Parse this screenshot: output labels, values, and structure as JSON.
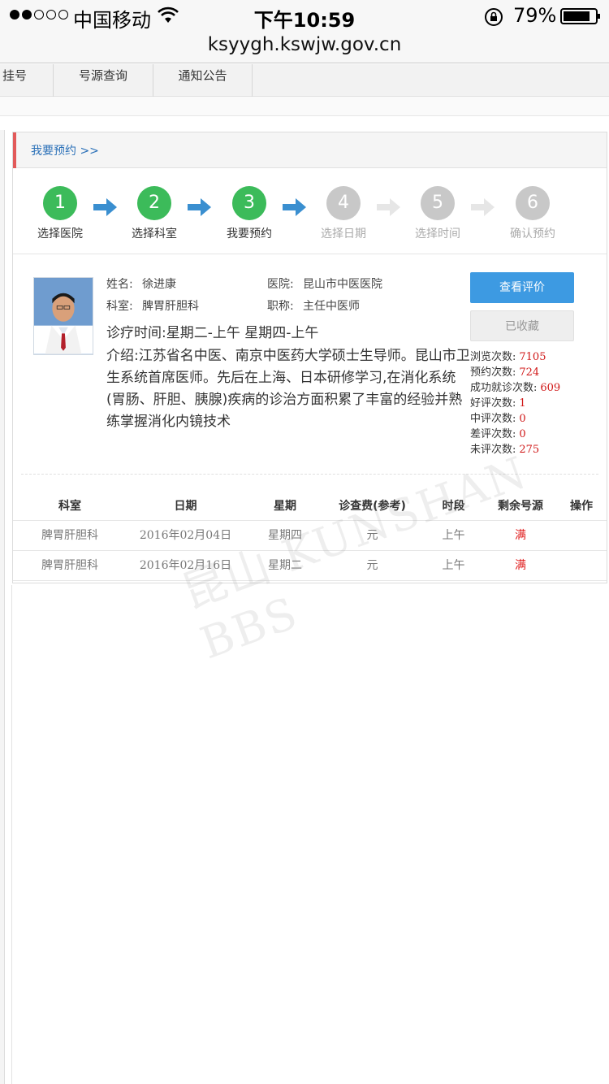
{
  "status_bar": {
    "carrier": "中国移动",
    "time": "下午10:59",
    "battery": "79%"
  },
  "browser": {
    "url": "ksyygh.kswjw.gov.cn"
  },
  "nav": {
    "tabs": [
      "挂号",
      "号源查询",
      "通知公告"
    ]
  },
  "breadcrumb": "我要预约 >>",
  "steps": [
    {
      "num": "1",
      "label": "选择医院",
      "done": true
    },
    {
      "num": "2",
      "label": "选择科室",
      "done": true
    },
    {
      "num": "3",
      "label": "我要预约",
      "done": true
    },
    {
      "num": "4",
      "label": "选择日期",
      "done": false
    },
    {
      "num": "5",
      "label": "选择时间",
      "done": false
    },
    {
      "num": "6",
      "label": "确认预约",
      "done": false
    }
  ],
  "doctor": {
    "name_label": "姓名:",
    "name": "徐进康",
    "hospital_label": "医院:",
    "hospital": "昆山市中医医院",
    "dept_label": "科室:",
    "dept": "脾胃肝胆科",
    "title_label": "职称:",
    "title": "主任中医师",
    "clinic_time": "诊疗时间:星期二-上午 星期四-上午",
    "intro": "介绍:江苏省名中医、南京中医药大学硕士生导师。昆山市卫生系统首席医师。先后在上海、日本研修学习,在消化系统(胃肠、肝胆、胰腺)疾病的诊治方面积累了丰富的经验并熟练掌握消化内镜技术"
  },
  "actions": {
    "view_reviews": "查看评价",
    "favorited": "已收藏"
  },
  "stats": [
    {
      "label": "浏览次数:",
      "value": "7105"
    },
    {
      "label": "预约次数:",
      "value": "724"
    },
    {
      "label": "成功就诊次数:",
      "value": "609"
    },
    {
      "label": "好评次数:",
      "value": "1"
    },
    {
      "label": "中评次数:",
      "value": "0"
    },
    {
      "label": "差评次数:",
      "value": "0"
    },
    {
      "label": "未评次数:",
      "value": "275"
    }
  ],
  "schedule": {
    "headers": [
      "科室",
      "日期",
      "星期",
      "诊查费(参考)",
      "时段",
      "剩余号源",
      "操作"
    ],
    "rows": [
      [
        "脾胃肝胆科",
        "2016年02月04日",
        "星期四",
        "元",
        "上午",
        "满",
        ""
      ],
      [
        "脾胃肝胆科",
        "2016年02月16日",
        "星期二",
        "元",
        "上午",
        "满",
        ""
      ]
    ]
  },
  "watermark": "昆山 KUNSHAN BBS",
  "colors": {
    "accent_blue": "#3d9ae2",
    "step_green": "#3cbb5a",
    "full_red": "#e01b1b",
    "link_blue": "#2a70b8"
  }
}
